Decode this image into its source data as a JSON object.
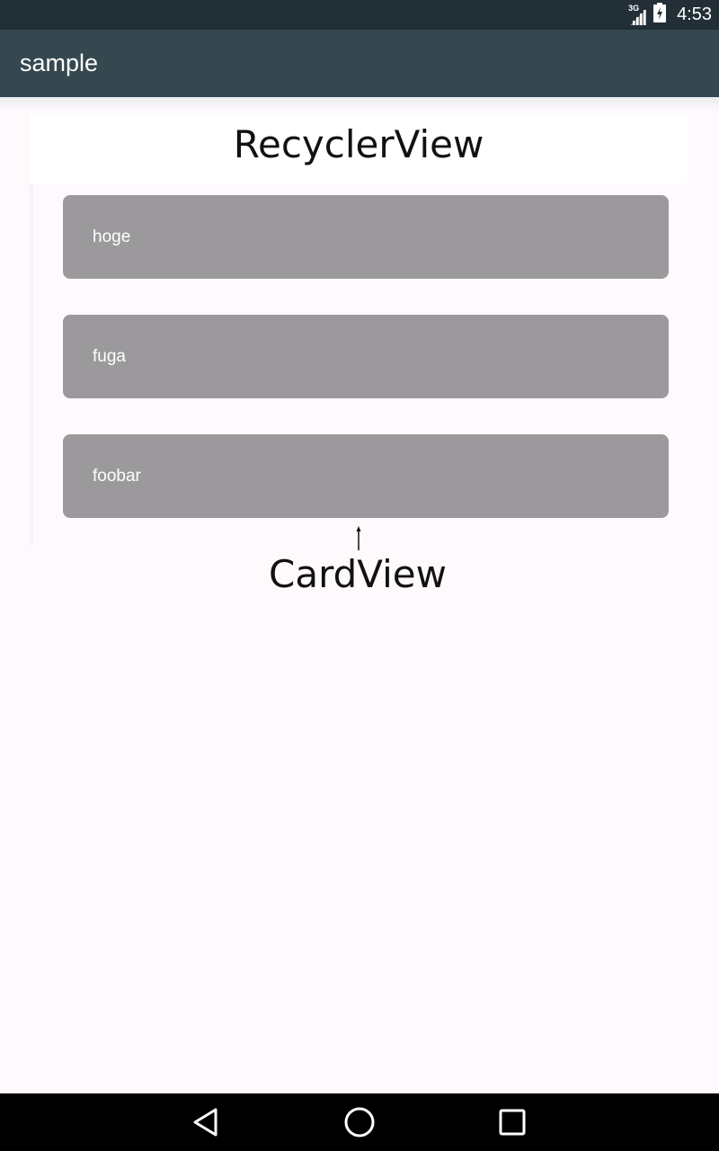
{
  "status_bar": {
    "network": "3G",
    "time": "4:53"
  },
  "app_bar": {
    "title": "sample"
  },
  "annotations": {
    "recycler_view": "RecyclerView",
    "card_view": "CardView"
  },
  "cards": [
    {
      "label": "hoge"
    },
    {
      "label": "fuga"
    },
    {
      "label": "foobar"
    }
  ],
  "colors": {
    "status_bar": "#232f36",
    "app_bar": "#35474f",
    "card": "#9b999c",
    "background": "#fdf9fd"
  },
  "icons": {
    "nav_back": "back-triangle-icon",
    "nav_home": "home-circle-icon",
    "nav_recents": "recents-square-icon"
  }
}
